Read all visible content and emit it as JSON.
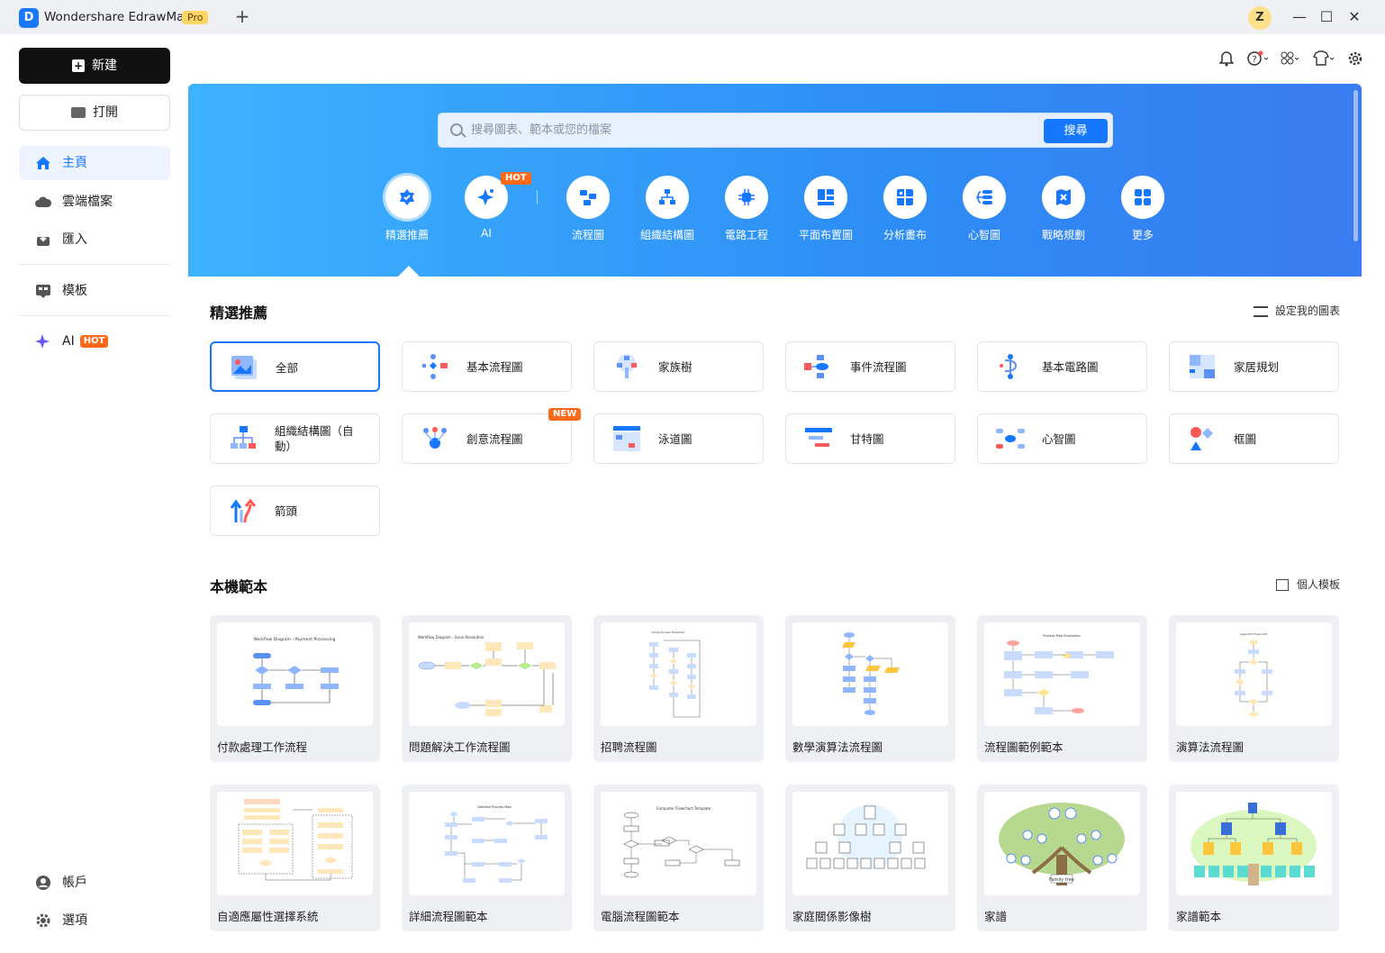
{
  "app": {
    "title": "Wondershare EdrawMax",
    "badge": "Pro",
    "new_tab": "+",
    "user_initial": "Z"
  },
  "window_controls": {
    "minimize": "—",
    "maximize": "☐",
    "close": "✕"
  },
  "sidebar": {
    "new_label": "新建",
    "open_label": "打開",
    "items": [
      {
        "label": "主頁"
      },
      {
        "label": "雲端檔案"
      },
      {
        "label": "匯入"
      },
      {
        "label": "模板"
      },
      {
        "label": "AI",
        "tag": "HOT"
      }
    ],
    "bottom": [
      {
        "label": "帳戶"
      },
      {
        "label": "選項"
      }
    ]
  },
  "search": {
    "placeholder": "搜尋圖表、範本或您的檔案",
    "button": "搜尋"
  },
  "categories": [
    {
      "label": "精選推薦",
      "icon": "featured-icon"
    },
    {
      "label": "AI",
      "icon": "ai-sparkle-icon",
      "tag": "HOT"
    },
    {
      "label": "流程圖",
      "icon": "flowchart-icon"
    },
    {
      "label": "組織結構圖",
      "icon": "org-chart-icon"
    },
    {
      "label": "電路工程",
      "icon": "circuit-icon"
    },
    {
      "label": "平面布置圖",
      "icon": "floor-plan-icon"
    },
    {
      "label": "分析畫布",
      "icon": "analysis-canvas-icon"
    },
    {
      "label": "心智圖",
      "icon": "mind-map-icon"
    },
    {
      "label": "戰略規劃",
      "icon": "strategy-icon"
    },
    {
      "label": "更多",
      "icon": "more-grid-icon"
    }
  ],
  "featured": {
    "title": "精選推薦",
    "settings_link": "設定我的圖表",
    "tiles": [
      {
        "label": "全部"
      },
      {
        "label": "基本流程圖"
      },
      {
        "label": "家族樹"
      },
      {
        "label": "事件流程圖"
      },
      {
        "label": "基本電路圖"
      },
      {
        "label": "家居規划"
      },
      {
        "label": "組織結構圖（自動）"
      },
      {
        "label": "創意流程圖",
        "tag": "NEW"
      },
      {
        "label": "泳道圖"
      },
      {
        "label": "甘特圖"
      },
      {
        "label": "心智圖"
      },
      {
        "label": "框圖"
      },
      {
        "label": "箭頭"
      }
    ]
  },
  "local_templates": {
    "title": "本機範本",
    "personal_link": "個人模板",
    "cards": [
      {
        "label": "付款處理工作流程",
        "thumb_title": "Workflow Diagram - Payment Processing"
      },
      {
        "label": "問題解決工作流程圖",
        "thumb_title": "Workflow Diagram - Issue Resolution"
      },
      {
        "label": "招聘流程圖",
        "thumb_title": "Hiring Process Flowchart"
      },
      {
        "label": "數學演算法流程圖",
        "thumb_title": ""
      },
      {
        "label": "流程圖範例範本",
        "thumb_title": "Process Map Illustration"
      },
      {
        "label": "演算法流程圖",
        "thumb_title": "Algorithm Flowchart"
      },
      {
        "label": "自適應屬性選擇系統",
        "thumb_title": ""
      },
      {
        "label": "詳細流程圖範本",
        "thumb_title": "Detailed Process Map"
      },
      {
        "label": "電腦流程圖範本",
        "thumb_title": "Computer Flowchart Template"
      },
      {
        "label": "家庭關係影像樹",
        "thumb_title": ""
      },
      {
        "label": "家譜",
        "thumb_title": "Family tree"
      },
      {
        "label": "家譜範本",
        "thumb_title": ""
      }
    ]
  },
  "colors": {
    "accent": "#1677ff",
    "hot": "#ff6a1a",
    "hero_start": "#3db2ff",
    "hero_end": "#3a7bf2"
  }
}
